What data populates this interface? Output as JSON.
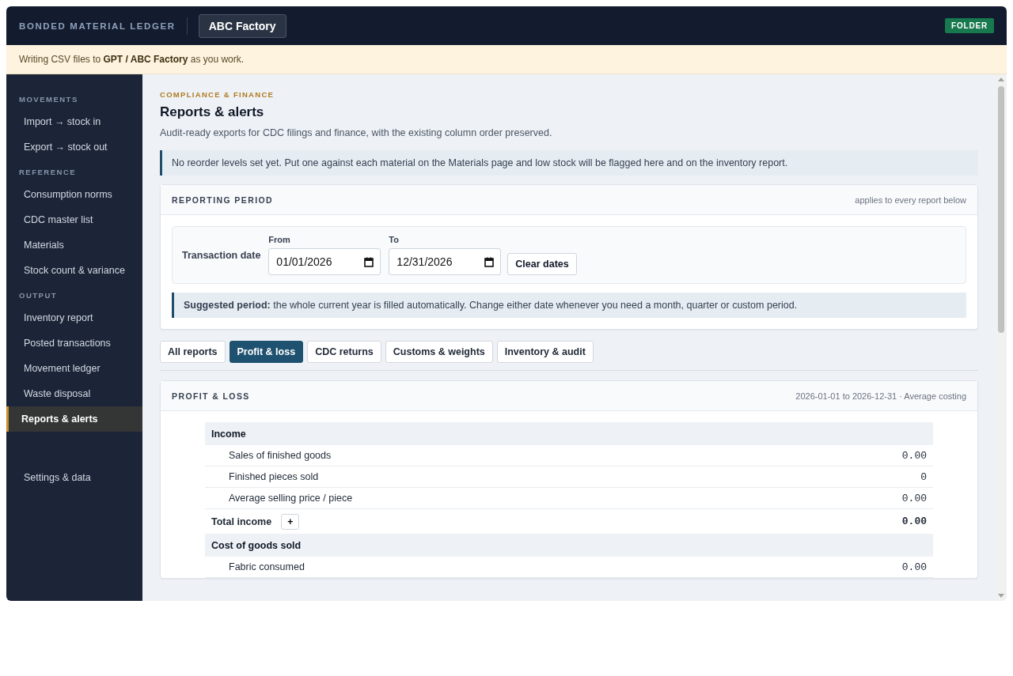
{
  "header": {
    "app_title": "BONDED MATERIAL LEDGER",
    "workspace": "ABC Factory",
    "badge": "FOLDER"
  },
  "banner": {
    "text": "Writing CSV files to **GPT / ABC Factory** as you work."
  },
  "sidebar": {
    "sections": [
      {
        "heading": "MOVEMENTS",
        "items": [
          {
            "label": "Import → stock in",
            "selected": false
          },
          {
            "label": "Export → stock out",
            "selected": false
          }
        ]
      },
      {
        "heading": "REFERENCE",
        "items": [
          {
            "label": "Consumption norms",
            "selected": false
          },
          {
            "label": "CDC master list",
            "selected": false
          },
          {
            "label": "Materials",
            "selected": false
          },
          {
            "label": "Stock count & variance",
            "selected": false
          }
        ]
      },
      {
        "heading": "OUTPUT",
        "items": [
          {
            "label": "Inventory report",
            "selected": false
          },
          {
            "label": "Posted transactions",
            "selected": false
          },
          {
            "label": "Movement ledger",
            "selected": false
          },
          {
            "label": "Waste disposal",
            "selected": false
          },
          {
            "label": "Reports & alerts",
            "selected": true
          }
        ]
      }
    ],
    "footer_item": {
      "label": "Settings & data",
      "selected": false
    }
  },
  "page": {
    "eyebrow": "COMPLIANCE & FINANCE",
    "title": "Reports & alerts",
    "subtitle": "Audit-ready exports for CDC filings and finance, with the existing column order preserved.",
    "notice": "No reorder levels set yet. Put one against each material on the Materials page and low stock will be flagged here and on the inventory report."
  },
  "reporting_period": {
    "title": "REPORTING PERIOD",
    "note": "applies to every report below",
    "field_label": "Transaction date",
    "from": {
      "label": "From",
      "value": "01/01/2026"
    },
    "to": {
      "label": "To",
      "value": "12/31/2026"
    },
    "clear_button": "Clear dates",
    "hint": "**Suggested period:** the whole current year is filled automatically. Change either date whenever you need a month, quarter or custom period."
  },
  "tabs": [
    {
      "label": "All reports",
      "selected": false
    },
    {
      "label": "Profit & loss",
      "selected": true
    },
    {
      "label": "CDC returns",
      "selected": false
    },
    {
      "label": "Customs & weights",
      "selected": false
    },
    {
      "label": "Inventory & audit",
      "selected": false
    }
  ],
  "report": {
    "title": "PROFIT & LOSS",
    "meta": "2026-01-01 to 2026-12-31 · Average costing",
    "rows": [
      {
        "kind": "section",
        "label": "Income"
      },
      {
        "kind": "line",
        "label": "Sales of finished goods",
        "value": "0.00"
      },
      {
        "kind": "line",
        "label": "Finished pieces sold",
        "value": "0"
      },
      {
        "kind": "line",
        "label": "Average selling price / piece",
        "value": "0.00"
      },
      {
        "kind": "total",
        "label": "Total income",
        "button": "+",
        "value": "0.00"
      },
      {
        "kind": "section",
        "label": "Cost of goods sold"
      },
      {
        "kind": "line",
        "label": "Fabric consumed",
        "value": "0.00"
      }
    ]
  }
}
